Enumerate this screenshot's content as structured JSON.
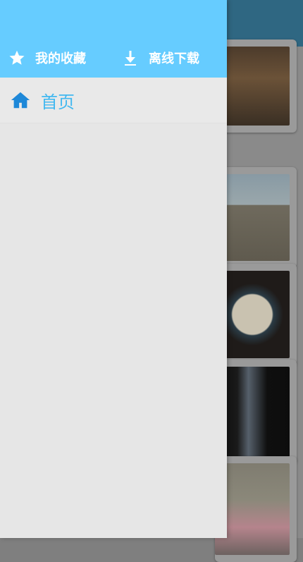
{
  "drawer": {
    "actions": [
      {
        "label": "我的收藏",
        "icon": "star-icon"
      },
      {
        "label": "离线下载",
        "icon": "download-icon"
      }
    ],
    "nav_items": [
      {
        "label": "首页",
        "icon": "home-icon"
      }
    ]
  },
  "colors": {
    "drawer_header": "#66ccff",
    "drawer_body": "#e6e6e6",
    "accent_text": "#42b8f0",
    "background_header": "#2f6782"
  }
}
